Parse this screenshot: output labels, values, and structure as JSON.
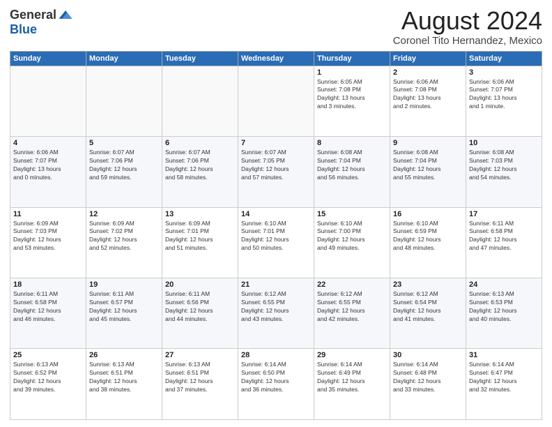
{
  "header": {
    "logo_general": "General",
    "logo_blue": "Blue",
    "month_title": "August 2024",
    "location": "Coronel Tito Hernandez, Mexico"
  },
  "days_of_week": [
    "Sunday",
    "Monday",
    "Tuesday",
    "Wednesday",
    "Thursday",
    "Friday",
    "Saturday"
  ],
  "weeks": [
    [
      {
        "day": "",
        "info": ""
      },
      {
        "day": "",
        "info": ""
      },
      {
        "day": "",
        "info": ""
      },
      {
        "day": "",
        "info": ""
      },
      {
        "day": "1",
        "info": "Sunrise: 6:05 AM\nSunset: 7:08 PM\nDaylight: 13 hours\nand 3 minutes."
      },
      {
        "day": "2",
        "info": "Sunrise: 6:06 AM\nSunset: 7:08 PM\nDaylight: 13 hours\nand 2 minutes."
      },
      {
        "day": "3",
        "info": "Sunrise: 6:06 AM\nSunset: 7:07 PM\nDaylight: 13 hours\nand 1 minute."
      }
    ],
    [
      {
        "day": "4",
        "info": "Sunrise: 6:06 AM\nSunset: 7:07 PM\nDaylight: 13 hours\nand 0 minutes."
      },
      {
        "day": "5",
        "info": "Sunrise: 6:07 AM\nSunset: 7:06 PM\nDaylight: 12 hours\nand 59 minutes."
      },
      {
        "day": "6",
        "info": "Sunrise: 6:07 AM\nSunset: 7:06 PM\nDaylight: 12 hours\nand 58 minutes."
      },
      {
        "day": "7",
        "info": "Sunrise: 6:07 AM\nSunset: 7:05 PM\nDaylight: 12 hours\nand 57 minutes."
      },
      {
        "day": "8",
        "info": "Sunrise: 6:08 AM\nSunset: 7:04 PM\nDaylight: 12 hours\nand 56 minutes."
      },
      {
        "day": "9",
        "info": "Sunrise: 6:08 AM\nSunset: 7:04 PM\nDaylight: 12 hours\nand 55 minutes."
      },
      {
        "day": "10",
        "info": "Sunrise: 6:08 AM\nSunset: 7:03 PM\nDaylight: 12 hours\nand 54 minutes."
      }
    ],
    [
      {
        "day": "11",
        "info": "Sunrise: 6:09 AM\nSunset: 7:03 PM\nDaylight: 12 hours\nand 53 minutes."
      },
      {
        "day": "12",
        "info": "Sunrise: 6:09 AM\nSunset: 7:02 PM\nDaylight: 12 hours\nand 52 minutes."
      },
      {
        "day": "13",
        "info": "Sunrise: 6:09 AM\nSunset: 7:01 PM\nDaylight: 12 hours\nand 51 minutes."
      },
      {
        "day": "14",
        "info": "Sunrise: 6:10 AM\nSunset: 7:01 PM\nDaylight: 12 hours\nand 50 minutes."
      },
      {
        "day": "15",
        "info": "Sunrise: 6:10 AM\nSunset: 7:00 PM\nDaylight: 12 hours\nand 49 minutes."
      },
      {
        "day": "16",
        "info": "Sunrise: 6:10 AM\nSunset: 6:59 PM\nDaylight: 12 hours\nand 48 minutes."
      },
      {
        "day": "17",
        "info": "Sunrise: 6:11 AM\nSunset: 6:58 PM\nDaylight: 12 hours\nand 47 minutes."
      }
    ],
    [
      {
        "day": "18",
        "info": "Sunrise: 6:11 AM\nSunset: 6:58 PM\nDaylight: 12 hours\nand 46 minutes."
      },
      {
        "day": "19",
        "info": "Sunrise: 6:11 AM\nSunset: 6:57 PM\nDaylight: 12 hours\nand 45 minutes."
      },
      {
        "day": "20",
        "info": "Sunrise: 6:11 AM\nSunset: 6:56 PM\nDaylight: 12 hours\nand 44 minutes."
      },
      {
        "day": "21",
        "info": "Sunrise: 6:12 AM\nSunset: 6:55 PM\nDaylight: 12 hours\nand 43 minutes."
      },
      {
        "day": "22",
        "info": "Sunrise: 6:12 AM\nSunset: 6:55 PM\nDaylight: 12 hours\nand 42 minutes."
      },
      {
        "day": "23",
        "info": "Sunrise: 6:12 AM\nSunset: 6:54 PM\nDaylight: 12 hours\nand 41 minutes."
      },
      {
        "day": "24",
        "info": "Sunrise: 6:13 AM\nSunset: 6:53 PM\nDaylight: 12 hours\nand 40 minutes."
      }
    ],
    [
      {
        "day": "25",
        "info": "Sunrise: 6:13 AM\nSunset: 6:52 PM\nDaylight: 12 hours\nand 39 minutes."
      },
      {
        "day": "26",
        "info": "Sunrise: 6:13 AM\nSunset: 6:51 PM\nDaylight: 12 hours\nand 38 minutes."
      },
      {
        "day": "27",
        "info": "Sunrise: 6:13 AM\nSunset: 6:51 PM\nDaylight: 12 hours\nand 37 minutes."
      },
      {
        "day": "28",
        "info": "Sunrise: 6:14 AM\nSunset: 6:50 PM\nDaylight: 12 hours\nand 36 minutes."
      },
      {
        "day": "29",
        "info": "Sunrise: 6:14 AM\nSunset: 6:49 PM\nDaylight: 12 hours\nand 35 minutes."
      },
      {
        "day": "30",
        "info": "Sunrise: 6:14 AM\nSunset: 6:48 PM\nDaylight: 12 hours\nand 33 minutes."
      },
      {
        "day": "31",
        "info": "Sunrise: 6:14 AM\nSunset: 6:47 PM\nDaylight: 12 hours\nand 32 minutes."
      }
    ]
  ]
}
